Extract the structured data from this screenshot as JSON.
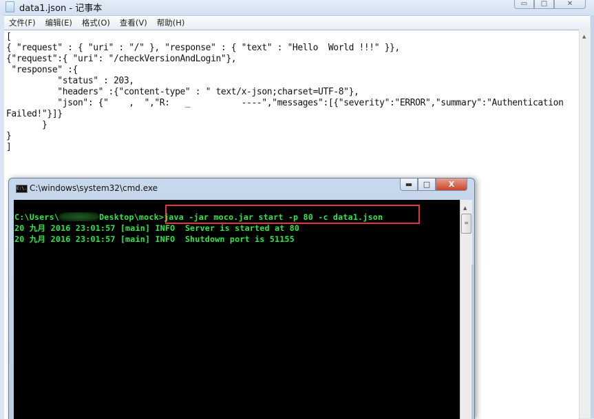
{
  "notepad": {
    "title": "data1.json - 记事本",
    "menu": [
      "文件(F)",
      "编辑(E)",
      "格式(O)",
      "查看(V)",
      "帮助(H)"
    ],
    "caption_buttons": {
      "minimize": "▭",
      "maximize": "□",
      "close": "✕"
    },
    "content": "[\n{ \"request\" : { \"uri\" : \"/\" }, \"response\" : { \"text\" : \"Hello  World !!!\" }},\n{\"request\":{ \"uri\": \"/checkVersionAndLogin\"},\n \"response\" :{\n          \"status\" : 203,\n          \"headers\" :{\"content-type\" : \" text/x-json;charset=UTF-8\"},\n          \"json\": {\"    ,  \",\"R:   _          ----\",\"messages\":[{\"severity\":\"ERROR\",\"summary\":\"Authentication\nFailed!\"}]}\n       }\n}\n]"
  },
  "cmd": {
    "title": "C:\\windows\\system32\\cmd.exe",
    "icon_label": "C:\\.",
    "caption_buttons": {
      "minimize": "▬",
      "maximize": "□",
      "close": "X"
    },
    "prompt_prefix": "C:\\Users\\",
    "prompt_suffix": "Desktop\\mock>",
    "command": "java -jar moco.jar start -p 80 -c data1.json",
    "log_lines": [
      "20 九月 2016 23:01:57 [main] INFO  Server is started at 80",
      "20 九月 2016 23:01:57 [main] INFO  Shutdown port is 51155"
    ],
    "highlight_color": "#e2363f",
    "text_color": "#2ee84a"
  }
}
